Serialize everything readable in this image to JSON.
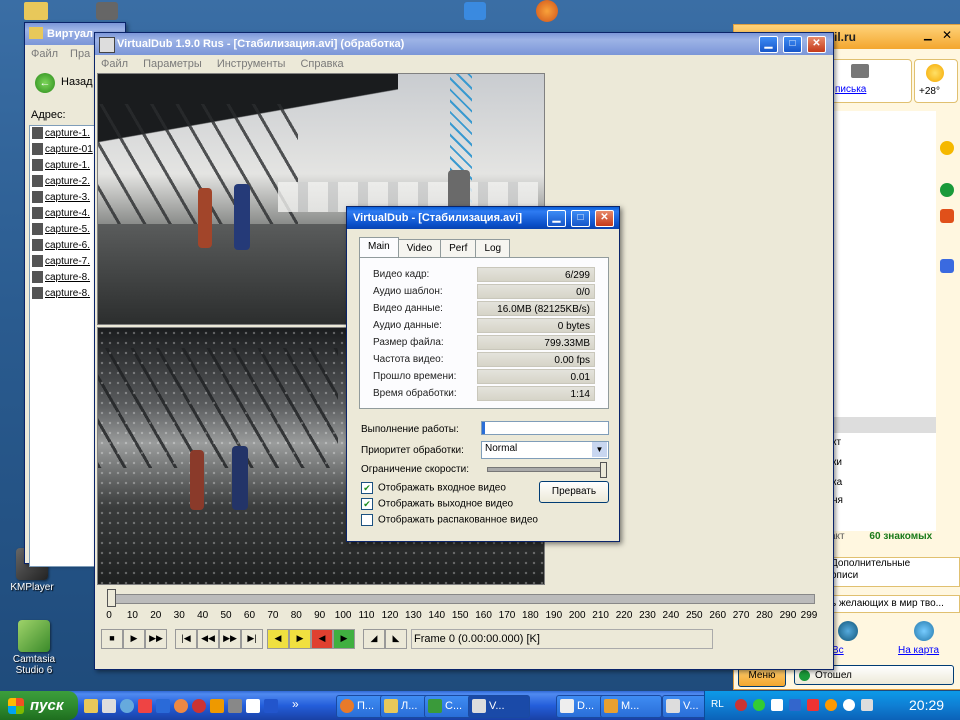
{
  "desktop": {
    "icons": [
      {
        "label": "KMPlayer"
      },
      {
        "label": "Camtasia Studio 6"
      }
    ]
  },
  "explorer": {
    "title": "Виртуал",
    "menu": [
      "Файл",
      "Пра"
    ],
    "back_label": "Назад",
    "address_label": "Адрес:",
    "files": [
      "capture-1.",
      "capture-01",
      "capture-1.",
      "capture-2.",
      "capture-3.",
      "capture-4.",
      "capture-5.",
      "capture-6.",
      "capture-7.",
      "capture-8.",
      "capture-8."
    ]
  },
  "vdub": {
    "title": "VirtualDub 1.9.0 Rus - [Стабилизация.avi] (обработка)",
    "menu": [
      "Файл",
      "Параметры",
      "Инструменты",
      "Справка"
    ],
    "timeline_ticks": [
      "0",
      "10",
      "20",
      "30",
      "40",
      "50",
      "60",
      "70",
      "80",
      "90",
      "100",
      "110",
      "120",
      "130",
      "140",
      "150",
      "160",
      "170",
      "180",
      "190",
      "200",
      "210",
      "220",
      "230",
      "240",
      "250",
      "260",
      "270",
      "280",
      "290",
      "299"
    ],
    "frame_status": "Frame 0 (0.00:00.000) [K]"
  },
  "status_dialog": {
    "title": "VirtualDub - [Стабилизация.avi]",
    "tabs": [
      "Main",
      "Video",
      "Perf",
      "Log"
    ],
    "active_tab": "Main",
    "stats": [
      {
        "label": "Видео кадр:",
        "value": "6/299"
      },
      {
        "label": "Аудио шаблон:",
        "value": "0/0"
      },
      {
        "label": "Видео данные:",
        "value": "16.0MB (82125KB/s)"
      },
      {
        "label": "Аудио данные:",
        "value": "0 bytes"
      },
      {
        "label": "Размер файла:",
        "value": "799.33MB"
      },
      {
        "label": "Частота видео:",
        "value": "0.00 fps"
      },
      {
        "label": "Прошло времени:",
        "value": "0.01"
      },
      {
        "label": "Время обработки:",
        "value": "1:14"
      }
    ],
    "progress_label": "Выполнение работы:",
    "progress_fraction": 0.02,
    "priority_label": "Приоритет обработки:",
    "priority_value": "Normal",
    "speed_label": "Ограничение скорости:",
    "speed_fraction": 1.0,
    "checkboxes": [
      {
        "label": "Отображать входное видео",
        "checked": true
      },
      {
        "label": "Отображать выходное видео",
        "checked": true
      },
      {
        "label": "Отображать распакованное видео",
        "checked": false
      }
    ],
    "abort_label": "Прервать"
  },
  "agent": {
    "title_fragment": "il.ru",
    "mail_label": "писька",
    "weather": "+28°",
    "contacts_fragment": [
      "кт",
      "ки",
      "ка",
      "ня"
    ],
    "status_left": "акт",
    "status_right": "60 знакомых",
    "ad1": "Дополнительные",
    "ad1b": "описи",
    "ad2": "ь желающих в мир тво...",
    "link_map": "Вс",
    "link_map2": "На карта",
    "menu_btn": "Меню",
    "status_btn": "Отошел"
  },
  "taskbar": {
    "start_label": "пуск",
    "items": [
      "П...",
      "Л...",
      "С...",
      "V...",
      "D...",
      "М...",
      "V..."
    ],
    "lang": "RL",
    "clock": "20:29"
  },
  "colors": {
    "xp_blue": "#0a4fc8",
    "desktop": "#2a5b8f",
    "start_green": "#2e8b2e",
    "agent_orange": "#e0a040"
  }
}
